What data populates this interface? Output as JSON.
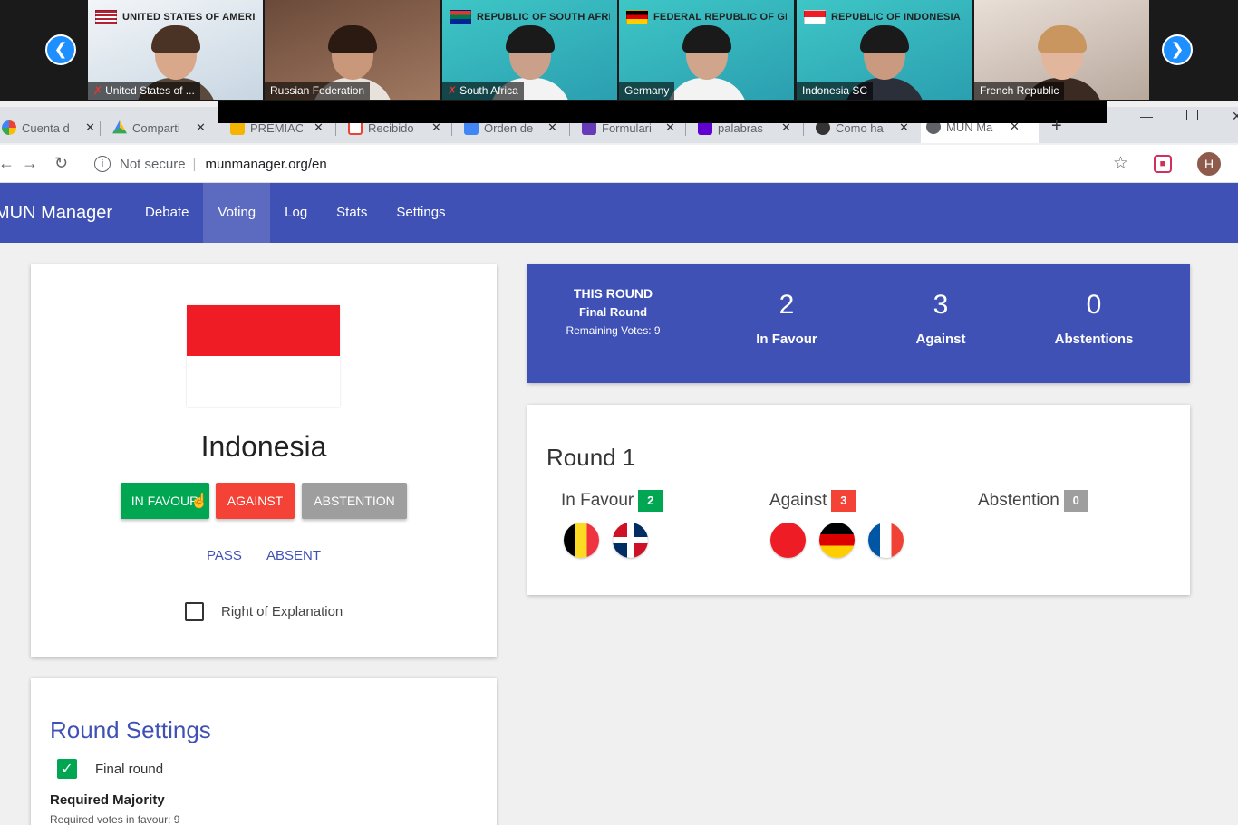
{
  "video_participants": [
    {
      "banner": "UNITED STATES OF AMERICA",
      "caption": "United States of ..."
    },
    {
      "banner": "",
      "caption": "Russian Federation"
    },
    {
      "banner": "REPUBLIC OF SOUTH AFRICA",
      "caption": "South Africa"
    },
    {
      "banner": "FEDERAL REPUBLIC OF GERMANY",
      "caption": "Germany"
    },
    {
      "banner": "REPUBLIC OF INDONESIA",
      "caption": "Indonesia SC"
    },
    {
      "banner": "",
      "caption": "French Republic"
    }
  ],
  "browser": {
    "tabs": [
      {
        "label": "Cuenta d"
      },
      {
        "label": "Comparti"
      },
      {
        "label": "PREMIAC"
      },
      {
        "label": "Recibido"
      },
      {
        "label": "Orden de"
      },
      {
        "label": "Formulari"
      },
      {
        "label": "palabras"
      },
      {
        "label": "Como ha"
      },
      {
        "label": "MUN Ma"
      }
    ],
    "security_label": "Not secure",
    "url": "munmanager.org/en",
    "avatar_initial": "H"
  },
  "app": {
    "brand": "MUN Manager",
    "nav": [
      "Debate",
      "Voting",
      "Log",
      "Stats",
      "Settings"
    ],
    "active_nav": "Voting"
  },
  "country_card": {
    "country": "Indonesia",
    "buttons": {
      "favour": "IN FAVOUR",
      "against": "AGAINST",
      "abstention": "ABSTENTION"
    },
    "pass": "PASS",
    "absent": "ABSENT",
    "right_of_explanation": "Right of Explanation"
  },
  "round_settings": {
    "title": "Round Settings",
    "final_round_label": "Final round",
    "required_majority": "Required Majority",
    "required_votes": "Required votes in favour: 9"
  },
  "summary": {
    "this_round": "THIS ROUND",
    "round_type": "Final Round",
    "remaining": "Remaining Votes: 9",
    "in_favour": {
      "value": "2",
      "label": "In Favour"
    },
    "against": {
      "value": "3",
      "label": "Against"
    },
    "abstentions": {
      "value": "0",
      "label": "Abstentions"
    }
  },
  "round": {
    "title": "Round 1",
    "in_favour": {
      "label": "In Favour",
      "count": "2"
    },
    "against": {
      "label": "Against",
      "count": "3"
    },
    "abstention": {
      "label": "Abstention",
      "count": "0"
    }
  },
  "colors": {
    "primary": "#3f51b5",
    "favour": "#00a651",
    "against": "#f44336",
    "abstention": "#9e9e9e"
  }
}
